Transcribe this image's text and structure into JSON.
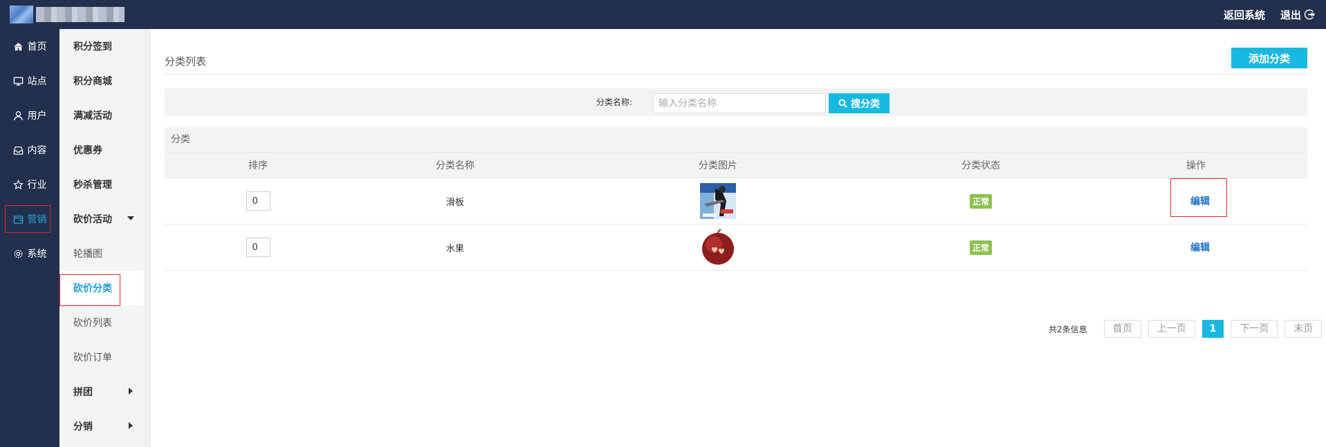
{
  "topbar": {
    "actions": {
      "back": "返回系统",
      "logout": "退出"
    }
  },
  "leftnav": {
    "items": [
      {
        "label": "首页",
        "icon": "home-icon"
      },
      {
        "label": "站点",
        "icon": "monitor-icon"
      },
      {
        "label": "用户",
        "icon": "user-icon"
      },
      {
        "label": "内容",
        "icon": "inbox-icon"
      },
      {
        "label": "行业",
        "icon": "star-icon"
      },
      {
        "label": "营销",
        "icon": "wallet-icon",
        "active": true
      },
      {
        "label": "系统",
        "icon": "gear-icon"
      }
    ]
  },
  "subnav": {
    "items": [
      {
        "label": "积分签到"
      },
      {
        "label": "积分商城"
      },
      {
        "label": "满减活动"
      },
      {
        "label": "优惠券"
      },
      {
        "label": "秒杀管理"
      },
      {
        "label": "砍价活动",
        "expanded": true
      },
      {
        "label": "轮播图"
      },
      {
        "label": "砍价分类",
        "current": true
      },
      {
        "label": "砍价列表"
      },
      {
        "label": "砍价订单"
      },
      {
        "label": "拼团"
      },
      {
        "label": "分销"
      }
    ]
  },
  "main": {
    "title": "分类列表",
    "add_button": "添加分类",
    "search": {
      "label": "分类名称:",
      "placeholder": "输入分类名称",
      "button": "搜分类"
    },
    "table": {
      "caption": "分类",
      "columns": [
        "排序",
        "分类名称",
        "分类图片",
        "分类状态",
        "操作"
      ],
      "rows": [
        {
          "sort": "0",
          "name": "滑板",
          "image": "skateboard-thumb",
          "status": "正常",
          "action": "编辑"
        },
        {
          "sort": "0",
          "name": "水果",
          "image": "apple-thumb",
          "status": "正常",
          "action": "编辑"
        }
      ]
    },
    "pager": {
      "info": "共2条信息",
      "first": "首页",
      "prev": "上一页",
      "current": "1",
      "next": "下一页",
      "last": "末页"
    }
  },
  "colors": {
    "sidebar_bg": "#22304d",
    "accent": "#18b9e1",
    "status_ok": "#8cc152",
    "highlight_box": "#e0242b"
  }
}
